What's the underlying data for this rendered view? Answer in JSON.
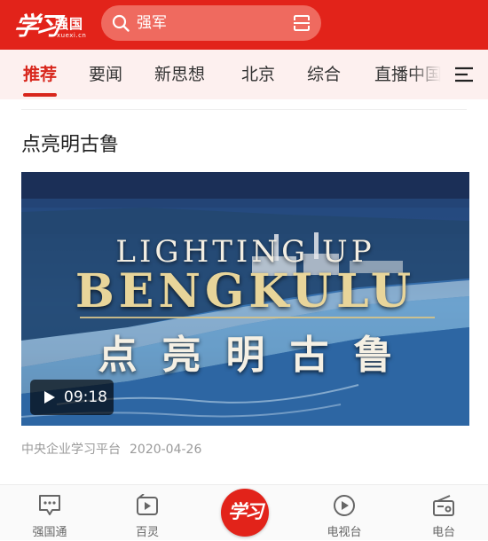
{
  "header": {
    "logo_script": "学习",
    "logo_name": "强国",
    "logo_sub": "xuexi.cn",
    "search_placeholder": "强军",
    "icons": {
      "search": "search-icon",
      "scan": "scan-icon"
    }
  },
  "tabs": {
    "items": [
      "推荐",
      "要闻",
      "新思想",
      "北京",
      "综合",
      "直播中国"
    ],
    "active": "推荐",
    "menu_icon": "menu-icon"
  },
  "article": {
    "title": "点亮明古鲁",
    "video": {
      "caption_en_line1": "LIGHTING UP",
      "caption_en_line2": "BENGKULU",
      "caption_cn": "点亮明古鲁",
      "duration": "09:18"
    },
    "source": "中央企业学习平台",
    "date": "2020-04-26"
  },
  "bottom_nav": {
    "items": [
      {
        "label": "强国通",
        "icon": "chat-icon"
      },
      {
        "label": "百灵",
        "icon": "video-play-icon"
      },
      {
        "label": "学习",
        "icon": "study-logo-icon"
      },
      {
        "label": "电视台",
        "icon": "tv-play-icon"
      },
      {
        "label": "电台",
        "icon": "radio-icon"
      }
    ]
  },
  "colors": {
    "brand_red": "#e2231a",
    "tab_bg": "#fdf0ef",
    "active_tab": "#d8261c"
  }
}
